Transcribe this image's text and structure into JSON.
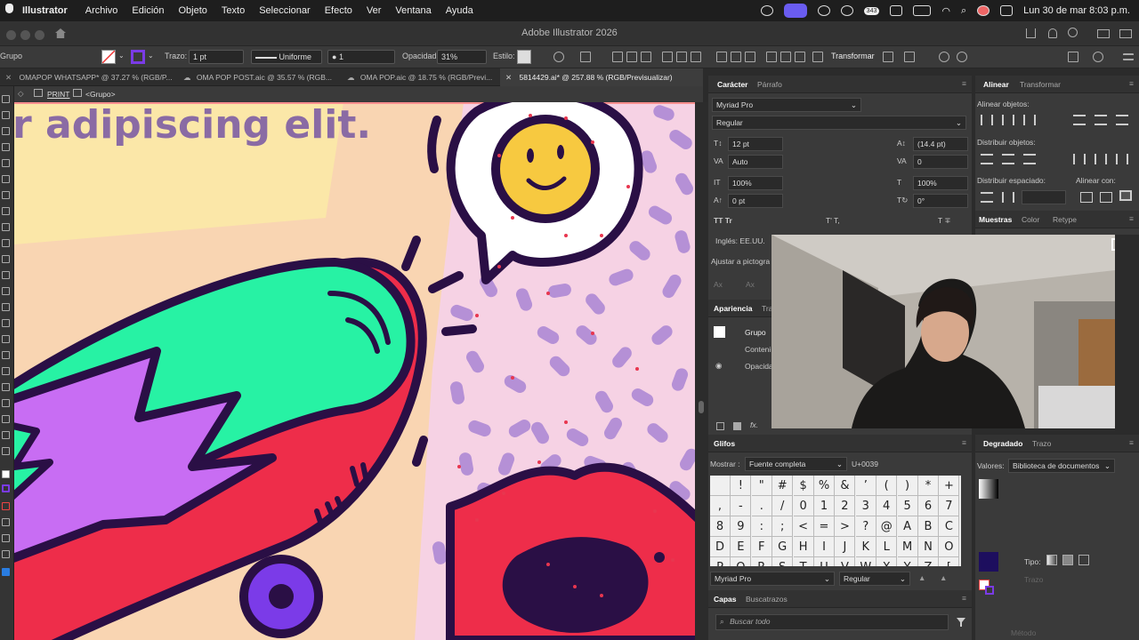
{
  "menubar": {
    "app": "Illustrator",
    "items": [
      "Archivo",
      "Edición",
      "Objeto",
      "Texto",
      "Seleccionar",
      "Efecto",
      "Ver",
      "Ventana",
      "Ayuda"
    ],
    "clock": "Lun 30 de mar  8:03 p.m.",
    "badge": "343"
  },
  "window": {
    "title": "Adobe Illustrator 2026"
  },
  "control": {
    "group_label": "Grupo",
    "stroke_label": "Trazo:",
    "stroke_weight": "1 pt",
    "stroke_profile": "Uniforme",
    "brush": "1",
    "opacity_label": "Opacidad:",
    "opacity": "31%",
    "style_label": "Estilo:",
    "transform_label": "Transformar",
    "fill_color": "#ffffff",
    "stroke_color": "#7a3be6"
  },
  "tabs": [
    {
      "label": "OMAPOP WHATSAPP* @ 37.27 % (RGB/P..."
    },
    {
      "label": "OMA POP POST.aic @ 35.57 % (RGB..."
    },
    {
      "label": "OMA POP.aic @ 18.75 % (RGB/Previ..."
    },
    {
      "label": "5814429.ai* @ 257.88 % (RGB/Previsualizar)"
    }
  ],
  "breadcrumb": {
    "layer": "PRINT",
    "group": "<Grupo>"
  },
  "canvas": {
    "headline": "r adipiscing elit."
  },
  "character": {
    "tab": "Carácter",
    "tab2": "Párrafo",
    "font": "Myriad Pro",
    "style": "Regular",
    "size": "12 pt",
    "leading": "(14.4 pt)",
    "kerning": "Auto",
    "tracking": "0",
    "vscale": "100%",
    "hscale": "100%",
    "baseline": "0 pt",
    "rotation": "0°",
    "language": "Inglés: EE.UU.",
    "snap": "Ajustar a pictogra"
  },
  "align": {
    "tab": "Alinear",
    "tab2": "Transformar",
    "align_objects": "Alinear objetos:",
    "distribute_objects": "Distribuir objetos:",
    "distribute_spacing": "Distribuir espaciado:",
    "align_to": "Alinear con:"
  },
  "swatches": {
    "tabs": [
      "Muestras",
      "Color",
      "Retype"
    ]
  },
  "appearance": {
    "tab": "Apariencia",
    "tab2": "Tra",
    "group": "Grupo",
    "content": "Conteni",
    "opacity": "Opacida"
  },
  "glyphs": {
    "tab": "Glifos",
    "show_label": "Mostrar :",
    "show_value": "Fuente completa",
    "unicode": "U+0039",
    "font": "Myriad Pro",
    "style": "Regular",
    "rows": [
      [
        " ",
        "!",
        "\"",
        "#",
        "$",
        "%",
        "&",
        "’",
        "(",
        ")",
        "*",
        "+"
      ],
      [
        ",",
        "-",
        ".",
        "/",
        "0",
        "1",
        "2",
        "3",
        "4",
        "5",
        "6",
        "7"
      ],
      [
        "8",
        "9",
        ":",
        ";",
        "<",
        "=",
        ">",
        "?",
        "@",
        "A",
        "B",
        "C"
      ],
      [
        "D",
        "E",
        "F",
        "G",
        "H",
        "I",
        "J",
        "K",
        "L",
        "M",
        "N",
        "O"
      ],
      [
        "P",
        "Q",
        "R",
        "S",
        "T",
        "U",
        "V",
        "W",
        "X",
        "Y",
        "Z",
        "["
      ]
    ]
  },
  "gradient": {
    "tab": "Degradado",
    "tab2": "Trazo",
    "values_label": "Valores:",
    "values": "Biblioteca de documentos",
    "type_label": "Tipo:",
    "stroke_label": "Trazo",
    "method": "Método"
  },
  "layers": {
    "tab": "Capas",
    "tab2": "Buscatrazos",
    "search_placeholder": "Buscar todo"
  }
}
